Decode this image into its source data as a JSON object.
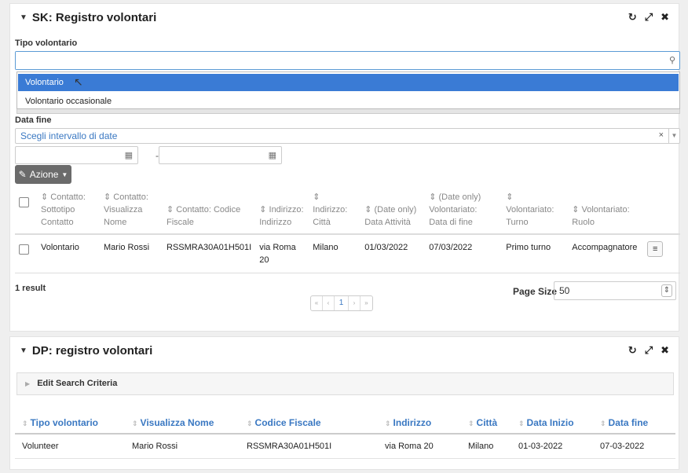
{
  "sk_panel": {
    "title": "SK: Registro volontari",
    "tipo_label": "Tipo volontario",
    "search_value": "",
    "dropdown_options": [
      "Volontario",
      "Volontario occasionale"
    ],
    "selected_option": "Volontario",
    "data_fine_label": "Data fine",
    "range_placeholder": "Scegli intervallo di date",
    "range_clear": "×",
    "date_separator": "-",
    "azione_label": "Azione",
    "columns": [
      [
        "⇕ Contatto:",
        "Sottotipo",
        "Contatto"
      ],
      [
        "⇕ Contatto:",
        "Visualizza",
        "Nome"
      ],
      [
        "⇕ Contatto: Codice",
        "Fiscale"
      ],
      [
        "⇕ Indirizzo:",
        "Indirizzo"
      ],
      [
        "⇕",
        "Indirizzo:",
        "Città"
      ],
      [
        "⇕ (Date only)",
        "Data Attività"
      ],
      [
        "⇕ (Date only)",
        "Volontariato:",
        "Data di fine"
      ],
      [
        "⇕",
        "Volontariato:",
        "Turno"
      ],
      [
        "⇕ Volontariato:",
        "Ruolo"
      ]
    ],
    "rows": [
      [
        "Volontario",
        "Mario Rossi",
        "RSSMRA30A01H501I",
        "via Roma 20",
        "Milano",
        "01/03/2022",
        "07/03/2022",
        "Primo turno",
        "Accompagnatore"
      ]
    ],
    "result_count": "1 result",
    "pager": [
      "«",
      "‹",
      "1",
      "›",
      "»"
    ],
    "page_size_label": "Page Size",
    "page_size_value": "50"
  },
  "dp_panel": {
    "title": "DP: registro volontari",
    "criteria_label": "Edit Search Criteria",
    "columns": [
      "Tipo volontario",
      "Visualizza Nome",
      "Codice Fiscale",
      "Indirizzo",
      "Città",
      "Data Inizio",
      "Data fine"
    ],
    "rows": [
      [
        "Volunteer",
        "Mario Rossi",
        "RSSMRA30A01H501I",
        "via Roma 20",
        "Milano",
        "01-03-2022",
        "07-03-2022"
      ]
    ]
  },
  "icons": {
    "refresh": "↻",
    "expand": "⤢",
    "close": "✖",
    "search": "🔍",
    "calendar": "▦",
    "pencil": "✎",
    "menu": "≡"
  },
  "colors": {
    "accent": "#3a7bd5",
    "link": "#3a78c2",
    "button_grey": "#6b6b6b"
  }
}
